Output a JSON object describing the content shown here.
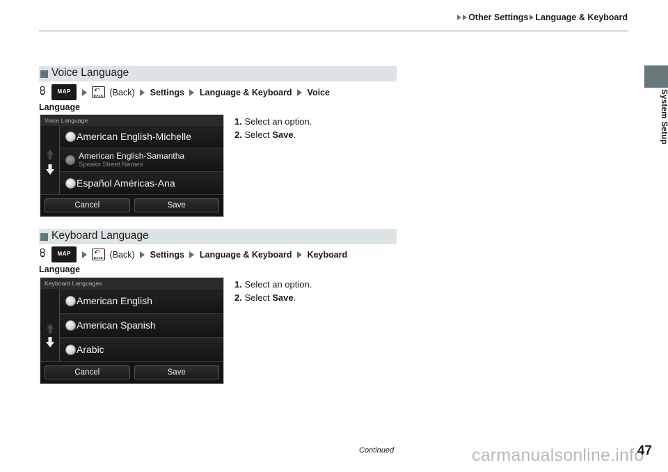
{
  "breadcrumb": {
    "item1": "Other Settings",
    "item2": "Language & Keyboard"
  },
  "side_tab": {
    "label": "System Setup",
    "color": "#67787a"
  },
  "sections": [
    {
      "title": "Voice Language",
      "path": {
        "hand_icon": "hand-press-icon",
        "map_button": "MAP",
        "back_button_label": "BACK",
        "back_paren": "(Back)",
        "step_settings": "Settings",
        "step_langkb": "Language & Keyboard",
        "step_target_1": "Voice",
        "step_target_2": "Language"
      },
      "screen": {
        "title": "Voice Language",
        "scroll_up_icon": "arrow-up-icon",
        "scroll_down_icon": "arrow-down-icon",
        "items": [
          {
            "label": "American English-Michelle",
            "sub": "",
            "radio": "bright",
            "size": "large"
          },
          {
            "label": "American English-Samantha",
            "sub": "Speaks Street Names",
            "radio": "dim",
            "size": "small"
          },
          {
            "label": "Español Américas-Ana",
            "sub": "",
            "radio": "bright",
            "size": "large"
          }
        ],
        "cancel": "Cancel",
        "save": "Save"
      },
      "steps": [
        {
          "num": "1.",
          "pre": "Select an option.",
          "bold": "",
          "post": ""
        },
        {
          "num": "2.",
          "pre": "Select ",
          "bold": "Save",
          "post": "."
        }
      ]
    },
    {
      "title": "Keyboard Language",
      "path": {
        "hand_icon": "hand-press-icon",
        "map_button": "MAP",
        "back_button_label": "BACK",
        "back_paren": "(Back)",
        "step_settings": "Settings",
        "step_langkb": "Language & Keyboard",
        "step_target_1": "Keyboard",
        "step_target_2": "Language"
      },
      "screen": {
        "title": "Keyboard Languages",
        "scroll_up_icon": "arrow-up-icon",
        "scroll_down_icon": "arrow-down-icon",
        "items": [
          {
            "label": "American English",
            "sub": "",
            "radio": "bright",
            "size": "large"
          },
          {
            "label": "American Spanish",
            "sub": "",
            "radio": "bright",
            "size": "large"
          },
          {
            "label": "Arabic",
            "sub": "",
            "radio": "bright",
            "size": "large"
          }
        ],
        "cancel": "Cancel",
        "save": "Save"
      },
      "steps": [
        {
          "num": "1.",
          "pre": "Select an option.",
          "bold": "",
          "post": ""
        },
        {
          "num": "2.",
          "pre": "Select ",
          "bold": "Save",
          "post": "."
        }
      ]
    }
  ],
  "footer": {
    "continued": "Continued",
    "page_number": "47",
    "watermark": "carmanualsonline.info"
  }
}
